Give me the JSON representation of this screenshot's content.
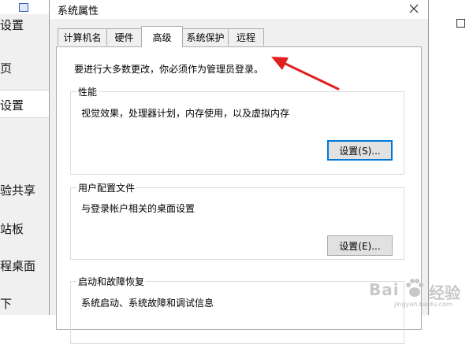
{
  "background_window": {
    "sidebar_items": [
      "设置",
      "页",
      "设置",
      "验共享",
      "站板",
      "程桌面",
      "下"
    ]
  },
  "dialog": {
    "title": "系统属性",
    "tabs": [
      {
        "label": "计算机名",
        "active": false
      },
      {
        "label": "硬件",
        "active": false
      },
      {
        "label": "高级",
        "active": true
      },
      {
        "label": "系统保护",
        "active": false
      },
      {
        "label": "远程",
        "active": false
      }
    ],
    "notice": "要进行大多数更改，你必须作为管理员登录。",
    "groups": [
      {
        "title": "性能",
        "description": "视觉效果，处理器计划，内存使用，以及虚拟内存",
        "button": "设置(S)..."
      },
      {
        "title": "用户配置文件",
        "description": "与登录帐户相关的桌面设置",
        "button": "设置(E)..."
      },
      {
        "title": "启动和故障恢复",
        "description": "系统启动、系统故障和调试信息"
      }
    ]
  },
  "annotation": {
    "arrow_color": "#e02020"
  },
  "watermark": {
    "text_left": "Bai",
    "text_right": "经验",
    "sub": "jingyan.baidu.com"
  }
}
